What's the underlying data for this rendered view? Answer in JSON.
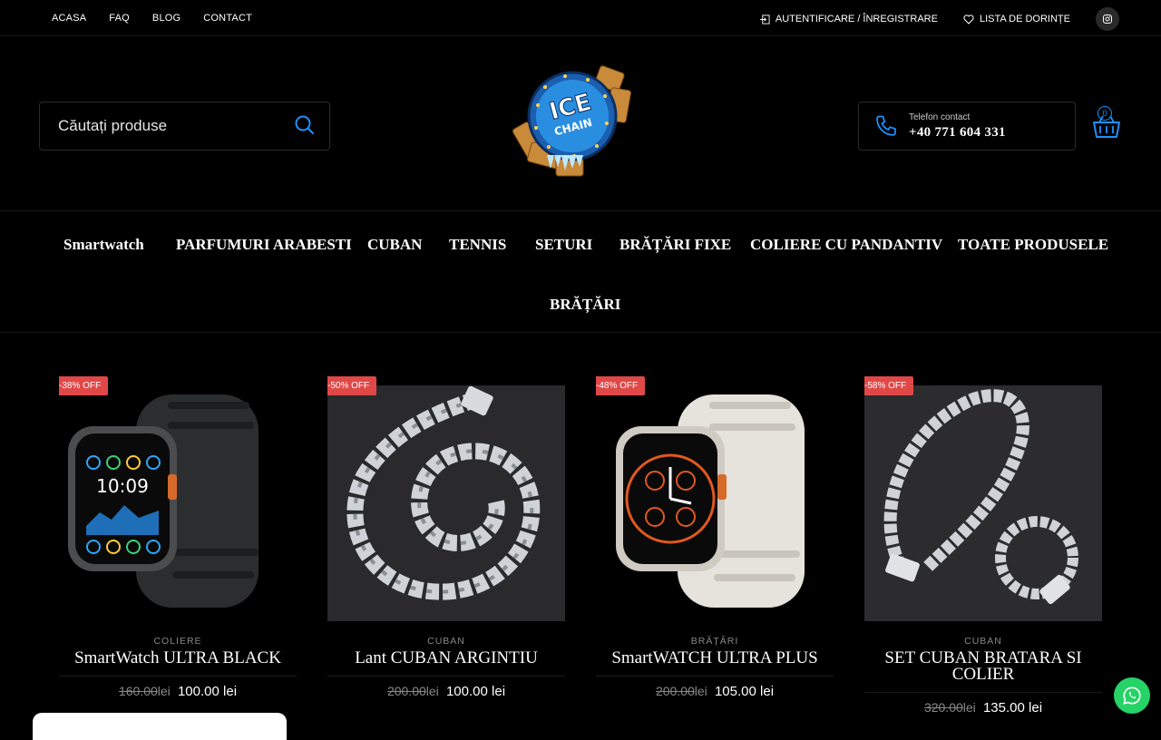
{
  "topbar": {
    "nav": [
      "ACASA",
      "FAQ",
      "BLOG",
      "CONTACT"
    ],
    "login": "AUTENTIFICARE / ÎNREGISTRARE",
    "wishlist": "LISTA DE DORINȚE"
  },
  "search": {
    "placeholder": "Căutați produse"
  },
  "phone": {
    "label": "Telefon contact",
    "number": "+40 771 604 331"
  },
  "cart": {
    "count": "0"
  },
  "logo": {
    "text_top": "ICE",
    "text_bottom": "CHAIN"
  },
  "mainnav": {
    "items": [
      "Smartwatch",
      "PARFUMURI ARABESTI",
      "CUBAN",
      "TENNIS",
      "SETURI",
      "BRĂȚĂRI FIXE",
      "COLIERE CU PANDANTIV",
      "TOATE PRODUSELE",
      "BRĂȚĂRI"
    ]
  },
  "products": [
    {
      "badge": "-38% OFF",
      "category": "COLIERE",
      "name": "SmartWatch ULTRA BLACK",
      "old_price": "160.00",
      "currency": "lei",
      "price": "100.00 lei"
    },
    {
      "badge": "-50% OFF",
      "category": "CUBAN",
      "name": "Lant CUBAN ARGINTIU",
      "old_price": "200.00",
      "currency": "lei",
      "price": "100.00 lei"
    },
    {
      "badge": "-48% OFF",
      "category": "BRĂȚĂRI",
      "name": "SmartWATCH ULTRA PLUS",
      "old_price": "200.00",
      "currency": "lei",
      "price": "105.00 lei"
    },
    {
      "badge": "-58% OFF",
      "category": "CUBAN",
      "name": "SET CUBAN BRATARA SI COLIER",
      "old_price": "320.00",
      "currency": "lei",
      "price": "135.00 lei"
    }
  ],
  "colors": {
    "accent": "#1e90ff",
    "badge": "#e04848",
    "whatsapp": "#25d366"
  }
}
